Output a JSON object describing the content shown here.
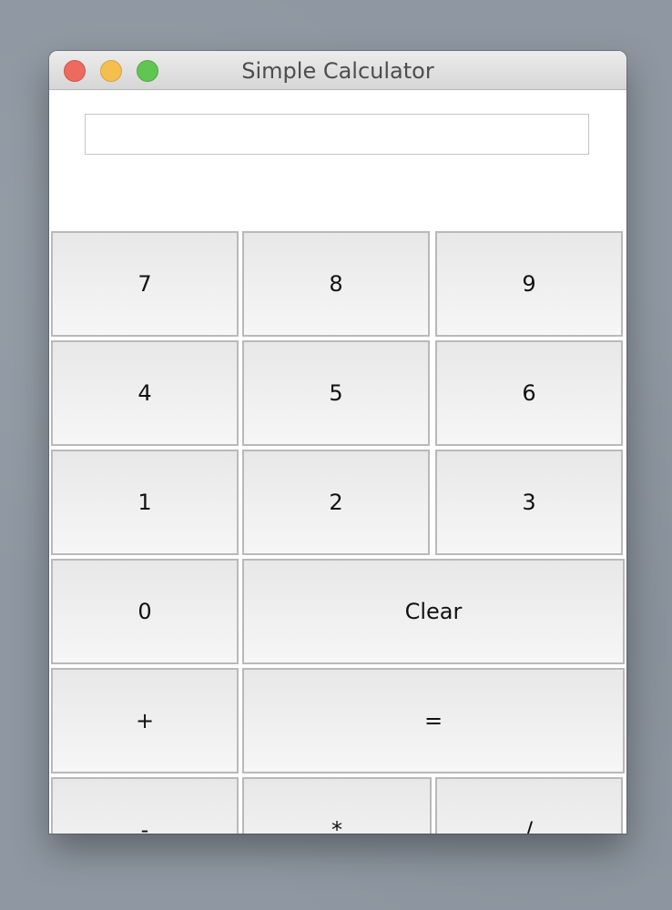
{
  "window": {
    "title": "Simple Calculator"
  },
  "display": {
    "value": "",
    "placeholder": ""
  },
  "buttons": {
    "seven": "7",
    "eight": "8",
    "nine": "9",
    "four": "4",
    "five": "5",
    "six": "6",
    "one": "1",
    "two": "2",
    "three": "3",
    "zero": "0",
    "clear": "Clear",
    "plus": "+",
    "equals": "=",
    "minus": "-",
    "multiply": "*",
    "divide": "/"
  },
  "colors": {
    "close": "#ed6a5e",
    "minimize": "#f5bf4f",
    "zoom": "#61c554"
  }
}
